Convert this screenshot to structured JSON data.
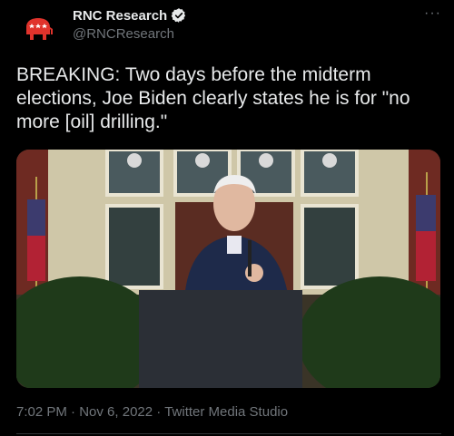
{
  "account": {
    "name": "RNC Research",
    "handle": "@RNCResearch",
    "verified": true,
    "avatar_icon": "gop-elephant-icon",
    "avatar_color": "#e0332c"
  },
  "tweet": {
    "text": "BREAKING: Two days before the midterm elections, Joe Biden clearly states he is for \"no more [oil] drilling.\"",
    "media": {
      "type": "video-frame",
      "description_icon": "speaker-at-podium-image"
    },
    "time": "7:02 PM",
    "date": "Nov 6, 2022",
    "source": "Twitter Media Studio",
    "separator": "·"
  },
  "menu": {
    "more_icon": "more-horizontal-icon",
    "more_label": "···"
  },
  "colors": {
    "background": "#000000",
    "text": "#e7e9ea",
    "muted": "#71767b",
    "verified": "#e7e9ea"
  }
}
